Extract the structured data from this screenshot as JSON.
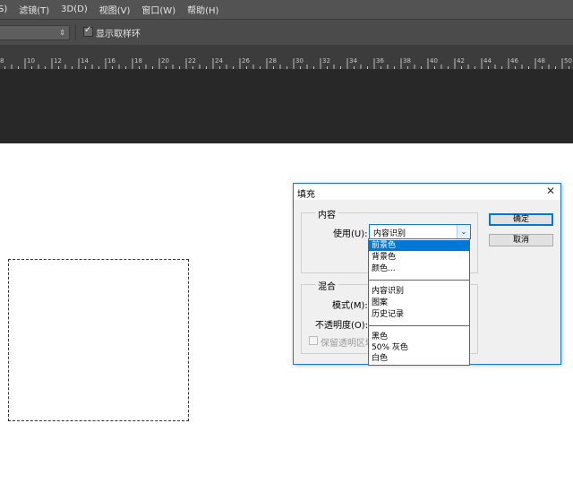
{
  "menubar": {
    "items": [
      "S)",
      "滤镜(T)",
      "3D(D)",
      "视图(V)",
      "窗口(W)",
      "帮助(H)"
    ]
  },
  "options_bar": {
    "sample_ring_label": "显示取样环",
    "sample_ring_checked": true
  },
  "ruler": {
    "labels": [
      "8",
      "10",
      "12",
      "14",
      "16",
      "18",
      "20",
      "22",
      "24",
      "26",
      "28",
      "30",
      "32",
      "34",
      "36",
      "38",
      "40",
      "42",
      "44",
      "46",
      "48",
      "50"
    ]
  },
  "dialog": {
    "title": "填充",
    "content_group": {
      "legend": "内容",
      "use_label": "使用(U):",
      "use_value": "内容识别"
    },
    "blend_group": {
      "legend": "混合",
      "mode_label": "模式(M):",
      "opacity_label": "不透明度(O):",
      "preserve_label": "保留透明区域"
    },
    "ok_label": "确定",
    "cancel_label": "取消"
  },
  "dropdown": {
    "selected": "前景色",
    "group1": [
      "前景色",
      "背景色",
      "颜色..."
    ],
    "group2": [
      "内容识别",
      "图案",
      "历史记录"
    ],
    "group3": [
      "黑色",
      "50% 灰色",
      "白色"
    ]
  },
  "colors": {
    "accent": "#0078d7",
    "ui_dark": "#535353"
  }
}
